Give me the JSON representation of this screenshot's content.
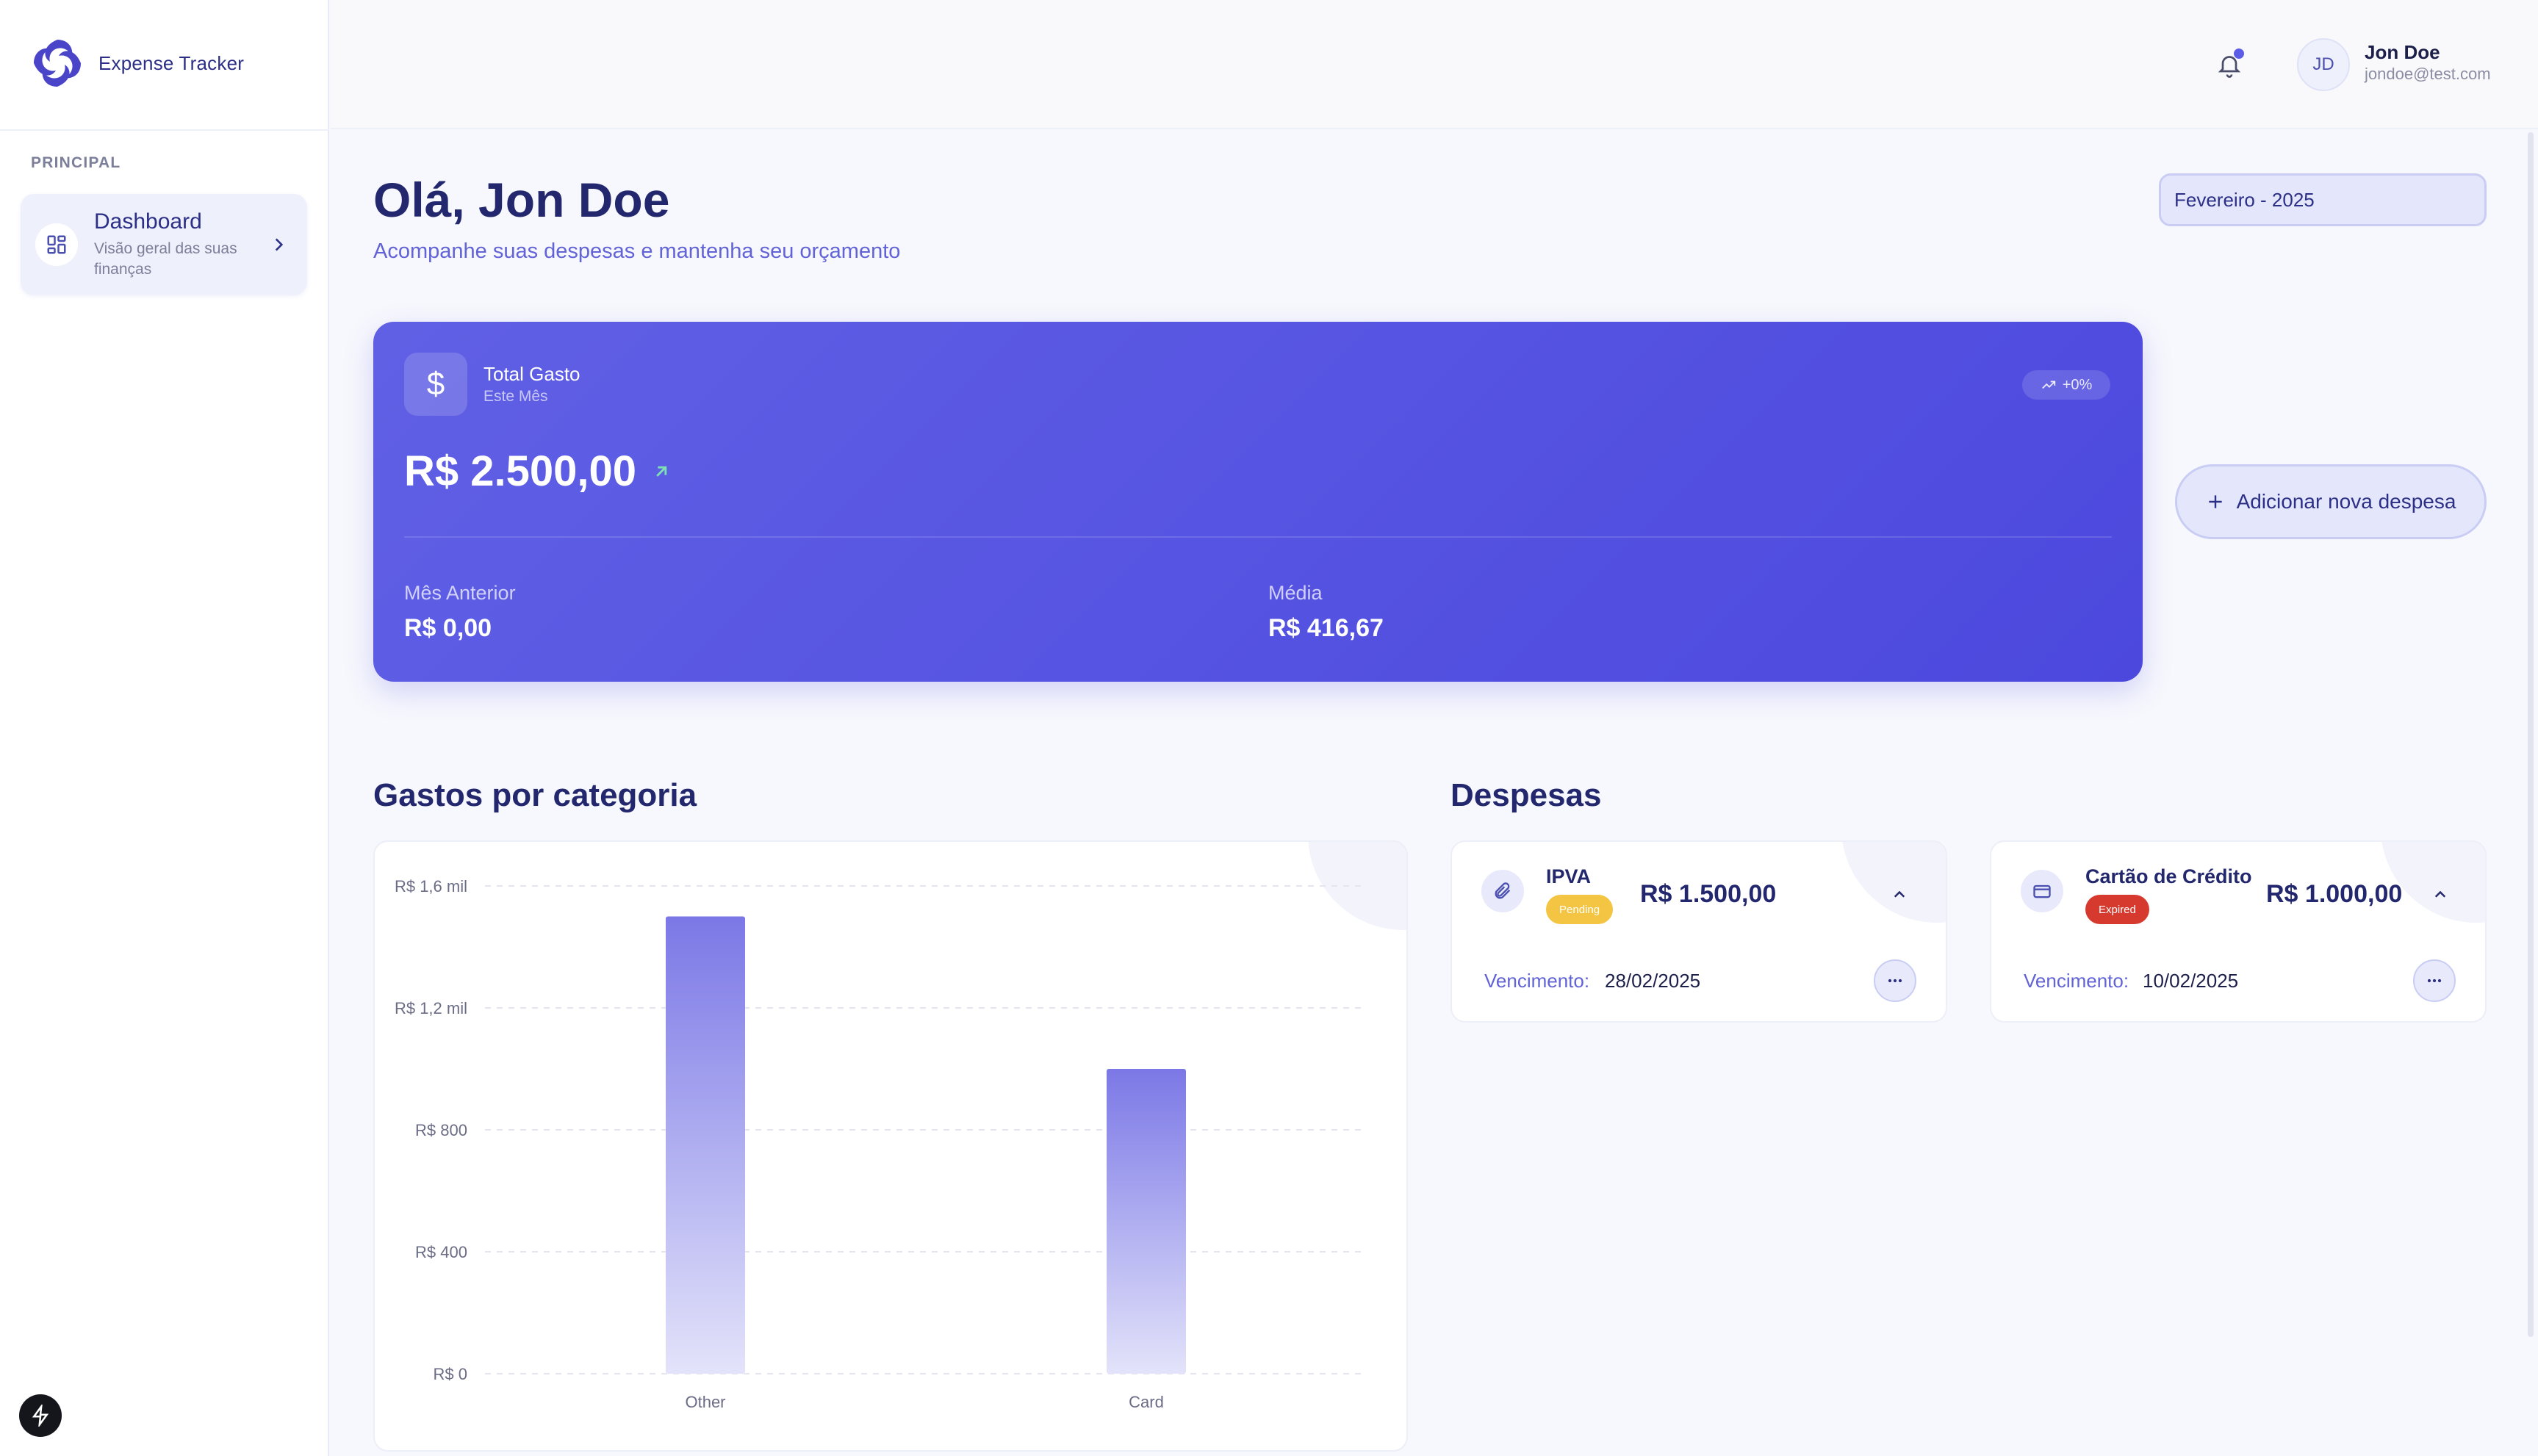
{
  "app": {
    "name": "Expense Tracker"
  },
  "sidebar": {
    "section": "PRINCIPAL",
    "items": [
      {
        "label": "Dashboard",
        "description": "Visão geral das suas finanças",
        "icon": "layout-grid-icon"
      }
    ]
  },
  "header": {
    "user": {
      "initials": "JD",
      "name": "Jon Doe",
      "email": "jondoe@test.com"
    },
    "notification_icon": "bell-icon"
  },
  "main": {
    "greeting": "Olá, Jon Doe",
    "subtitle": "Acompanhe suas despesas e mantenha seu orçamento",
    "month_selector": {
      "value": "Fevereiro - 2025"
    },
    "summary": {
      "label": "Total Gasto",
      "period": "Este Mês",
      "trend": "+0%",
      "total": "R$ 2.500,00",
      "previous_label": "Mês Anterior",
      "previous_value": "R$ 0,00",
      "average_label": "Média",
      "average_value": "R$ 416,67"
    },
    "add_button": "Adicionar nova despesa",
    "chart_section_title": "Gastos por categoria",
    "expenses_section_title": "Despesas",
    "expenses": [
      {
        "title": "IPVA",
        "status": "Pending",
        "status_color": "#f4c542",
        "amount": "R$ 1.500,00",
        "due_label": "Vencimento:",
        "due_date": "28/02/2025",
        "icon": "paperclip-icon"
      },
      {
        "title": "Cartão de Crédito",
        "status": "Expired",
        "status_color": "#d63a2f",
        "amount": "R$ 1.000,00",
        "due_label": "Vencimento:",
        "due_date": "10/02/2025",
        "icon": "credit-card-icon"
      }
    ]
  },
  "chart_data": {
    "type": "bar",
    "categories": [
      "Other",
      "Card"
    ],
    "values": [
      1500,
      1000
    ],
    "ylim": [
      0,
      1600
    ],
    "y_ticks": [
      0,
      400,
      800,
      1200,
      1600
    ],
    "y_tick_labels": [
      "R$ 0",
      "R$ 400",
      "R$ 800",
      "R$ 1,2 mil",
      "R$ 1,6 mil"
    ],
    "grid": true,
    "bar_color_top": "#7b78e6",
    "bar_color_bottom": "#e3e3fa"
  }
}
